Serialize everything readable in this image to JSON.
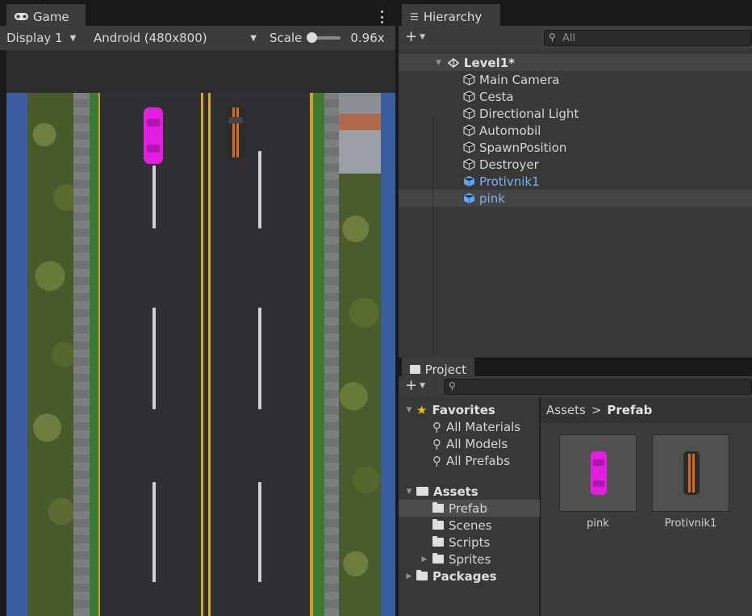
{
  "game": {
    "tab_label": "Game",
    "display_label": "Display 1",
    "resolution_label": "Android (480x800)",
    "scale_label": "Scale",
    "scale_value": "0.96x",
    "menu_icon": "kebab-menu-icon"
  },
  "hierarchy": {
    "tab_label": "Hierarchy",
    "search_placeholder": "All",
    "scene": "Level1*",
    "items": [
      {
        "label": "Main Camera",
        "icon": "gameobject-icon",
        "prefab": false
      },
      {
        "label": "Cesta",
        "icon": "gameobject-icon",
        "prefab": false
      },
      {
        "label": "Directional Light",
        "icon": "gameobject-icon",
        "prefab": false
      },
      {
        "label": "Automobil",
        "icon": "gameobject-icon",
        "prefab": false
      },
      {
        "label": "SpawnPosition",
        "icon": "gameobject-icon",
        "prefab": false
      },
      {
        "label": "Destroyer",
        "icon": "gameobject-icon",
        "prefab": false
      },
      {
        "label": "Protivnik1",
        "icon": "prefab-icon",
        "prefab": true
      },
      {
        "label": "pink",
        "icon": "prefab-icon",
        "prefab": true
      }
    ]
  },
  "project": {
    "tab_label": "Project",
    "search_placeholder": "",
    "favorites_label": "Favorites",
    "favorites": [
      "All Materials",
      "All Models",
      "All Prefabs"
    ],
    "assets_label": "Assets",
    "asset_folders": [
      "Prefab",
      "Scenes",
      "Scripts",
      "Sprites"
    ],
    "packages_label": "Packages",
    "breadcrumb_root": "Assets",
    "breadcrumb_sep": ">",
    "breadcrumb_current": "Prefab",
    "assets": [
      {
        "label": "pink",
        "color": "#e21ee0"
      },
      {
        "label": "Protivnik1",
        "color": "#2b2b2b"
      }
    ]
  },
  "colors": {
    "pink_car": "#e21ee0",
    "dark_car": "#2b2b2b",
    "dark_car_stripe": "#d86a1a",
    "road": "#2e3033",
    "yellow_line": "#d6a828",
    "prefab_text": "#7cb0f0",
    "favorite_star": "#f0c020"
  }
}
